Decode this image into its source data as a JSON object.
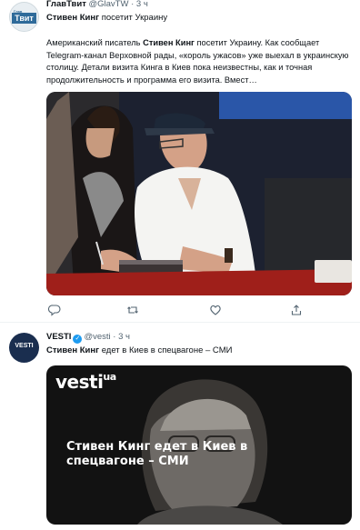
{
  "tweets": [
    {
      "avatar_text": "Твит",
      "avatar_small": "Глав",
      "name": "ГлавТвит",
      "handle": "@GlavTW",
      "time": "· 3 ч",
      "headline_bold": "Стивен Кинг",
      "headline_rest": " посетит Украину",
      "body_pre": "Американский писатель ",
      "body_bold": "Стивен Кинг",
      "body_post": " посетит Украину. Как сообщает Telegram-канал Верховной рады, «король ужасов» уже выехал в украинскую столицу. Детали визита Кинга в Киев пока неизвестны, как и точная продолжительность и программа его визита. Вмест…",
      "actions": [
        "reply-icon",
        "retweet-icon",
        "like-icon",
        "share-icon"
      ]
    },
    {
      "avatar_text": "VESTI",
      "name": "VESTI",
      "handle": "@vesti",
      "time": "· 3 ч",
      "headline_bold": "Стивен Кинг",
      "headline_rest": " едет в Киев в спецвагоне – СМИ",
      "media_logo": "vesti",
      "media_logo_suffix": "ua",
      "media_headline": "Стивен Кинг едет в Киев в спецвагоне – СМИ"
    }
  ],
  "colors": {
    "text": "#0f1419",
    "muted": "#536471",
    "verified": "#1d9bf0",
    "divider": "#eff3f4"
  }
}
